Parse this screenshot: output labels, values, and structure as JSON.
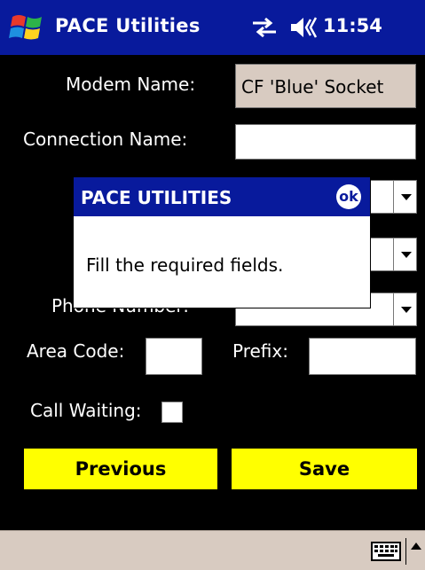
{
  "titlebar": {
    "title": "PACE Utilities",
    "time": "11:54"
  },
  "form": {
    "modem_name_label": "Modem Name:",
    "modem_name_value": "CF 'Blue' Socket",
    "connection_name_label": "Connection Name:",
    "connection_name_value": "",
    "phone_number_label": "Phone Number:",
    "area_code_label": "Area Code:",
    "prefix_label": "Prefix:",
    "call_waiting_label": "Call Waiting:",
    "call_waiting_checked": false
  },
  "buttons": {
    "previous_label": "Previous",
    "save_label": "Save"
  },
  "dialog": {
    "title": "PACE UTILITIES",
    "ok_label": "ok",
    "message": "Fill the required fields."
  },
  "icons": {
    "start": "windows-flag-icon",
    "connectivity": "connectivity-icon",
    "volume": "speaker-icon",
    "ok": "ok-icon",
    "keyboard": "keyboard-icon",
    "sip_arrow": "chevron-up-icon"
  },
  "colors": {
    "titlebar": "#081a9c",
    "button": "#ffff00",
    "background": "#000000",
    "readonly_field": "#d8cbc1",
    "bottombar": "#d8cbc1"
  }
}
